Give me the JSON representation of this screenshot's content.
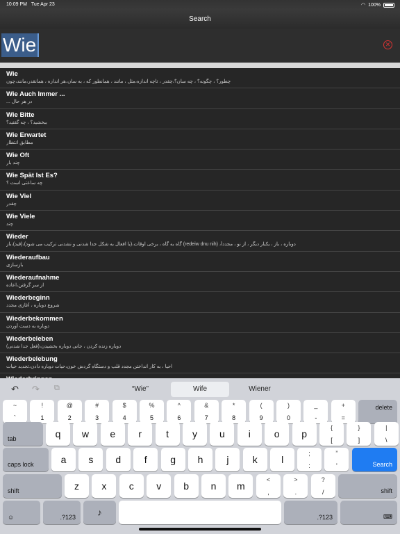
{
  "status": {
    "time": "10:09 PM",
    "date": "Tue Apr 23",
    "battery": "100%"
  },
  "nav": {
    "title": "Search"
  },
  "search": {
    "value": "Wie"
  },
  "results": [
    {
      "word": "Wie",
      "def": "چطور؟ ، چگونه؟ ، چه سان؟،چقدر ، تاچه اندازه،مثل ، مانند ، همانطور که ، به سان،هر اندازه ، همانقدر،مانند،چون"
    },
    {
      "word": "Wie Auch Immer ...",
      "def": "در هر حال ..."
    },
    {
      "word": "Wie Bitte",
      "def": "ببخشید؟ ، چه گفتید؟"
    },
    {
      "word": "Wie Erwartet",
      "def": "مطابق انتظار"
    },
    {
      "word": "Wie Oft",
      "def": "چند بار"
    },
    {
      "word": "Wie Spät Ist Es?",
      "def": "چه ساعتی است ؟"
    },
    {
      "word": "Wie Viel",
      "def": "چقدر"
    },
    {
      "word": "Wie Viele",
      "def": "چند"
    },
    {
      "word": "Wieder",
      "def": "دوباره ، باز ، یکبار دیگر ، از نو ، مجدداً، (redeiw dnu nih) گاه به گاه ، برخی اوقات،(با افعال به شکل جدا شدنی و نشدنی ترکیب می شود)،(قید)،باز"
    },
    {
      "word": "Wiederaufbau",
      "def": "بازسازی"
    },
    {
      "word": "Wiederaufnahme",
      "def": "از سر گرفتن،اعاده"
    },
    {
      "word": "Wiederbeginn",
      "def": "شروع دوباره ، آغازی مجدد"
    },
    {
      "word": "Wiederbekommen",
      "def": "دوباره به دست آوردن"
    },
    {
      "word": "Wiederbeleben",
      "def": "دوباره زنده کردن ، جانی دوباره بخشیدن،(فعل جدا شدنی)"
    },
    {
      "word": "Wiederbelebung",
      "def": "احیا ، به کار انداختن مجدد قلب و دستگاه گردش خون،حیات دوباره دادن،تجدید حیات"
    },
    {
      "word": "Wiederbringen",
      "def": ""
    }
  ],
  "keyboard": {
    "suggestions": [
      "“Wie”",
      "Wife",
      "Wiener"
    ],
    "row1": [
      [
        "~",
        "`"
      ],
      [
        "!",
        "1"
      ],
      [
        "@",
        "2"
      ],
      [
        "#",
        "3"
      ],
      [
        "$",
        "4"
      ],
      [
        "%",
        "5"
      ],
      [
        "^",
        "6"
      ],
      [
        "&",
        "7"
      ],
      [
        "*",
        "8"
      ],
      [
        "(",
        "9"
      ],
      [
        ")",
        "0"
      ],
      [
        "_",
        "-"
      ],
      [
        "+",
        "="
      ]
    ],
    "delete": "delete",
    "tab": "tab",
    "row2": [
      "q",
      "w",
      "e",
      "r",
      "t",
      "y",
      "u",
      "i",
      "o",
      "p"
    ],
    "row2_extra": [
      [
        "{",
        "["
      ],
      [
        "}",
        "]"
      ],
      [
        "|",
        "\\"
      ]
    ],
    "caps": "caps lock",
    "row3": [
      "a",
      "s",
      "d",
      "f",
      "g",
      "h",
      "j",
      "k",
      "l"
    ],
    "row3_extra": [
      [
        ";",
        ":"
      ],
      [
        "”",
        "’"
      ]
    ],
    "search_key": "Search",
    "shift": "shift",
    "row4": [
      "z",
      "x",
      "c",
      "v",
      "b",
      "n",
      "m"
    ],
    "row4_extra": [
      [
        "<",
        ","
      ],
      [
        ">",
        "."
      ],
      [
        "?",
        "/"
      ]
    ],
    "numkey": ".?123"
  }
}
